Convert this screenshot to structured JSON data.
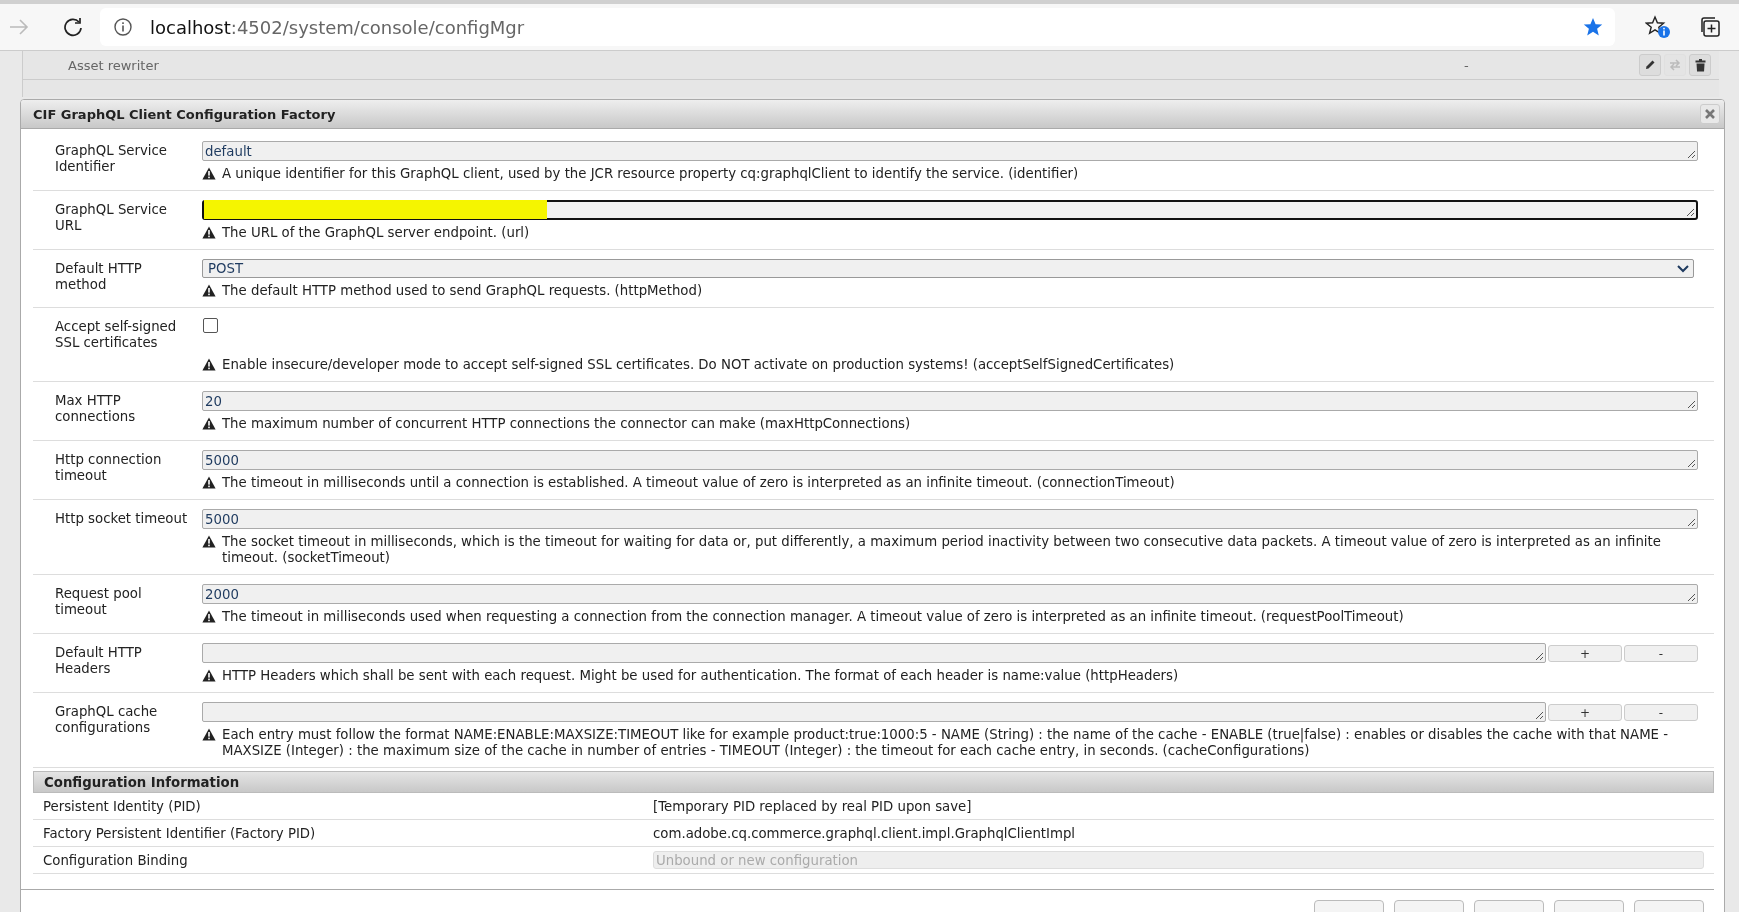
{
  "browser": {
    "url_host": "localhost",
    "url_path": ":4502/system/console/configMgr",
    "bookmarked": true
  },
  "background_list": [
    {
      "name": "Asset rewriter",
      "version": "-"
    }
  ],
  "dialog": {
    "title": "CIF GraphQL Client Configuration Factory",
    "fields": [
      {
        "kind": "text",
        "label": "GraphQL Service Identifier",
        "value": "default",
        "focused": false,
        "help": "A unique identifier for this GraphQL client, used by the JCR resource property cq:graphqlClient to identify the service. (identifier)"
      },
      {
        "kind": "text",
        "label": "GraphQL Service URL",
        "focused": true,
        "redacted": true,
        "help": "The URL of the GraphQL server endpoint. (url)"
      },
      {
        "kind": "select",
        "label": "Default HTTP method",
        "value": "POST",
        "help": "The default HTTP method used to send GraphQL requests. (httpMethod)"
      },
      {
        "kind": "checkbox",
        "label": "Accept self-signed SSL certificates",
        "checked": false,
        "help": "Enable insecure/developer mode to accept self-signed SSL certificates. Do NOT activate on production systems! (acceptSelfSignedCertificates)"
      },
      {
        "kind": "text",
        "label": "Max HTTP connections",
        "value": "20",
        "focused": false,
        "help": "The maximum number of concurrent HTTP connections the connector can make (maxHttpConnections)"
      },
      {
        "kind": "text",
        "label": "Http connection timeout",
        "value": "5000",
        "focused": false,
        "help": "The timeout in milliseconds until a connection is established. A timeout value of zero is interpreted as an infinite timeout. (connectionTimeout)"
      },
      {
        "kind": "text",
        "label": "Http socket timeout",
        "value": "5000",
        "focused": false,
        "help": "The socket timeout in milliseconds, which is the timeout for waiting for data or, put differently, a maximum period inactivity between two consecutive data packets. A timeout value of zero is interpreted as an infinite timeout. (socketTimeout)"
      },
      {
        "kind": "text",
        "label": "Request pool timeout",
        "value": "2000",
        "focused": false,
        "help": "The timeout in milliseconds used when requesting a connection from the connection manager. A timeout value of zero is interpreted as an infinite timeout. (requestPoolTimeout)"
      },
      {
        "kind": "multi",
        "label": "Default HTTP Headers",
        "add": "+",
        "remove": "-",
        "help": "HTTP Headers which shall be sent with each request. Might be used for authentication. The format of each header is name:value (httpHeaders)"
      },
      {
        "kind": "multi",
        "label": "GraphQL cache configurations",
        "add": "+",
        "remove": "-",
        "help": "Each entry must follow the format NAME:ENABLE:MAXSIZE:TIMEOUT like for example product:true:1000:5 - NAME (String) : the name of the cache - ENABLE (true|false) : enables or disables the cache with that NAME - MAXSIZE (Integer) : the maximum size of the cache in number of entries - TIMEOUT (Integer) : the timeout for each cache entry, in seconds. (cacheConfigurations)"
      }
    ],
    "info": {
      "title": "Configuration Information",
      "rows": [
        {
          "kind": "text",
          "label": "Persistent Identity (PID)",
          "value": "[Temporary PID replaced by real PID upon save]"
        },
        {
          "kind": "text",
          "label": "Factory Persistent Identifier (Factory PID)",
          "value": "com.adobe.cq.commerce.graphql.client.impl.GraphqlClientImpl"
        },
        {
          "kind": "disabled-field",
          "label": "Configuration Binding",
          "value": "Unbound or new configuration"
        }
      ]
    }
  }
}
